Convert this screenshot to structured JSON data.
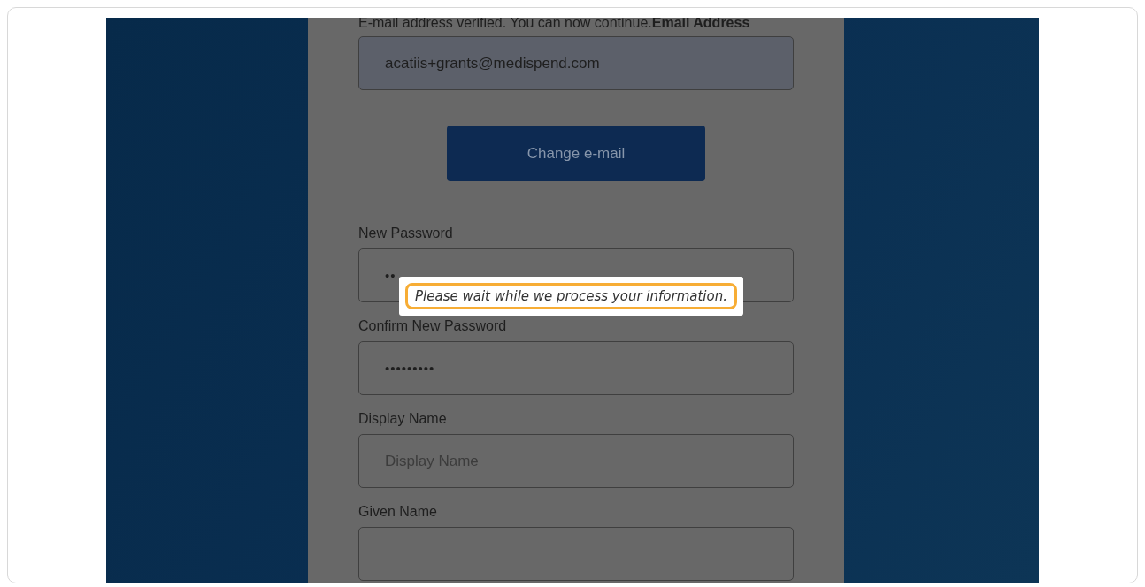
{
  "notice": "E-mail address verified. You can now continue.**Email Address**",
  "email_field": {
    "value": "acatiis+grants@medispend.com",
    "disabled": true
  },
  "change_email_button": {
    "label": "Change e-mail"
  },
  "fields": [
    {
      "label": "New Password",
      "kind": "password",
      "value": "••"
    },
    {
      "label": "Confirm New Password",
      "kind": "password",
      "value": "•••••••••"
    },
    {
      "label": "Display Name",
      "kind": "text",
      "placeholder": "Display Name"
    },
    {
      "label": "Given Name",
      "kind": "text"
    }
  ],
  "toast": {
    "message": "Please wait while we process your information."
  }
}
